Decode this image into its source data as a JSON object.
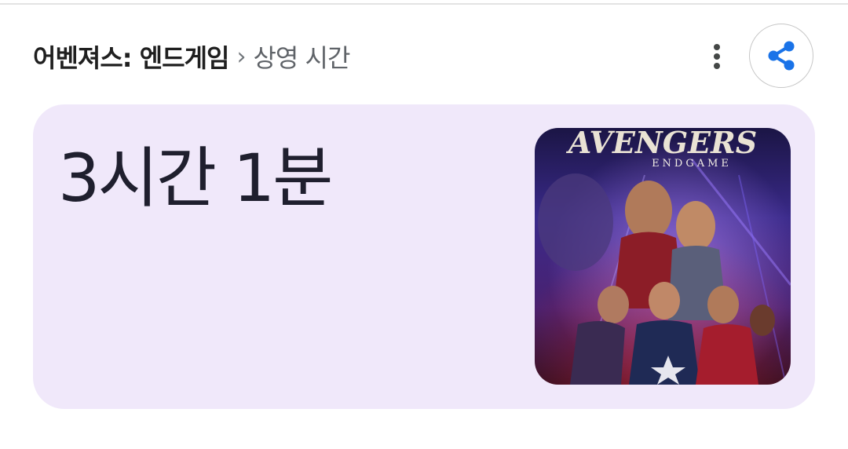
{
  "header": {
    "movie_title": "어벤져스: 엔드게임",
    "separator": "›",
    "subtitle": "상영 시간"
  },
  "runtime": {
    "value": "3시간 1분"
  },
  "poster": {
    "title_text": "AVENGERS",
    "subtitle_text": "ENDGAME"
  },
  "icons": {
    "more": "more-vert-icon",
    "share": "share-icon"
  },
  "colors": {
    "card_bg": "#f0e8fa",
    "share_blue": "#1a73e8"
  }
}
